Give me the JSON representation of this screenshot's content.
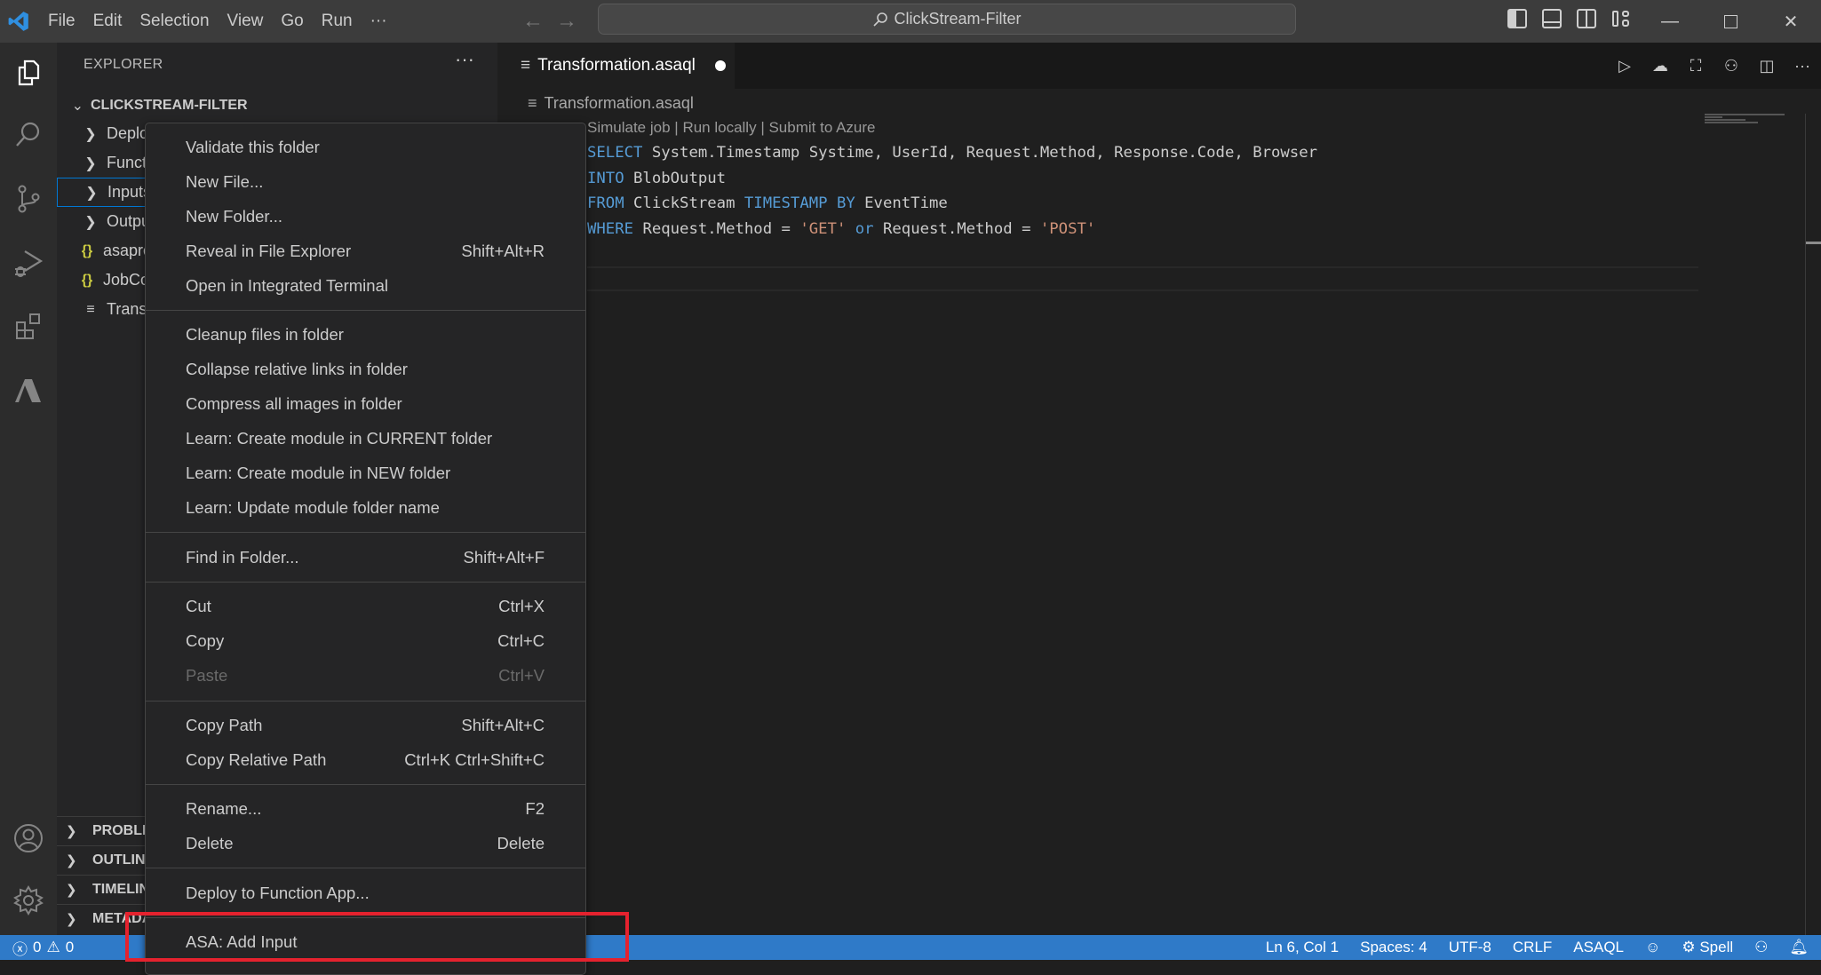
{
  "titlebar": {
    "menu": [
      "File",
      "Edit",
      "Selection",
      "View",
      "Go",
      "Run",
      "···"
    ],
    "search_text": "ClickStream-Filter"
  },
  "activitybar": {
    "items": [
      "explorer-icon",
      "search-icon",
      "source-control-icon",
      "run-debug-icon",
      "extensions-icon",
      "azure-icon"
    ],
    "bottom": [
      "accounts-icon",
      "settings-gear-icon"
    ]
  },
  "sidebar": {
    "title": "EXPLORER",
    "more": "···",
    "root": "CLICKSTREAM-FILTER",
    "tree": [
      {
        "label": "Deploy",
        "type": "folder"
      },
      {
        "label": "Functions",
        "type": "folder"
      },
      {
        "label": "Inputs",
        "type": "folder",
        "selected": true
      },
      {
        "label": "Outputs",
        "type": "folder"
      },
      {
        "label": "asaproj.json",
        "type": "json"
      },
      {
        "label": "JobConfig.json",
        "type": "json"
      },
      {
        "label": "Transformation.asaql",
        "type": "asaql"
      }
    ],
    "panels": [
      "PROBLEMS",
      "OUTLINE",
      "TIMELINE",
      "METADATA"
    ]
  },
  "editor": {
    "tab": {
      "label": "Transformation.asaql",
      "dirty": true
    },
    "breadcrumb": "Transformation.asaql",
    "codelens": [
      "Simulate job",
      "Run locally",
      "Submit to Azure"
    ],
    "lines": [
      "SELECT System.Timestamp Systime, UserId, Request.Method, Response.Code, Browser",
      "INTO BlobOutput",
      "FROM ClickStream TIMESTAMP BY EventTime",
      "WHERE Request.Method = 'GET' or Request.Method = 'POST'",
      ""
    ]
  },
  "context_menu": {
    "items": [
      {
        "label": "Validate this folder",
        "shortcut": ""
      },
      {
        "label": "New File...",
        "shortcut": ""
      },
      {
        "label": "New Folder...",
        "shortcut": ""
      },
      {
        "label": "Reveal in File Explorer",
        "shortcut": "Shift+Alt+R"
      },
      {
        "label": "Open in Integrated Terminal",
        "shortcut": ""
      },
      {
        "label": "Cleanup files in folder",
        "shortcut": ""
      },
      {
        "label": "Collapse relative links in folder",
        "shortcut": ""
      },
      {
        "label": "Compress all images in folder",
        "shortcut": ""
      },
      {
        "label": "Learn: Create module in CURRENT folder",
        "shortcut": ""
      },
      {
        "label": "Learn: Create module in NEW folder",
        "shortcut": ""
      },
      {
        "label": "Learn: Update module folder name",
        "shortcut": ""
      },
      {
        "label": "Find in Folder...",
        "shortcut": "Shift+Alt+F"
      },
      {
        "label": "Cut",
        "shortcut": "Ctrl+X"
      },
      {
        "label": "Copy",
        "shortcut": "Ctrl+C"
      },
      {
        "label": "Paste",
        "shortcut": "Ctrl+V",
        "disabled": true
      },
      {
        "label": "Copy Path",
        "shortcut": "Shift+Alt+C"
      },
      {
        "label": "Copy Relative Path",
        "shortcut": "Ctrl+K Ctrl+Shift+C"
      },
      {
        "label": "Rename...",
        "shortcut": "F2"
      },
      {
        "label": "Delete",
        "shortcut": "Delete"
      },
      {
        "label": "Deploy to Function App...",
        "shortcut": ""
      },
      {
        "label": "ASA: Add Input",
        "shortcut": ""
      }
    ],
    "highlighted_item": "ASA: Add Input"
  },
  "statusbar": {
    "errors": "0",
    "warnings": "0",
    "position": "Ln 6, Col 1",
    "indent": "Spaces: 4",
    "encoding": "UTF-8",
    "eol": "CRLF",
    "language": "ASAQL",
    "spell": "Spell"
  },
  "colors": {
    "accent": "#0078d4",
    "statusbar": "#2f7ac8",
    "highlight_box": "#e5222e",
    "keyword": "#569cd6",
    "string": "#ce9178"
  }
}
